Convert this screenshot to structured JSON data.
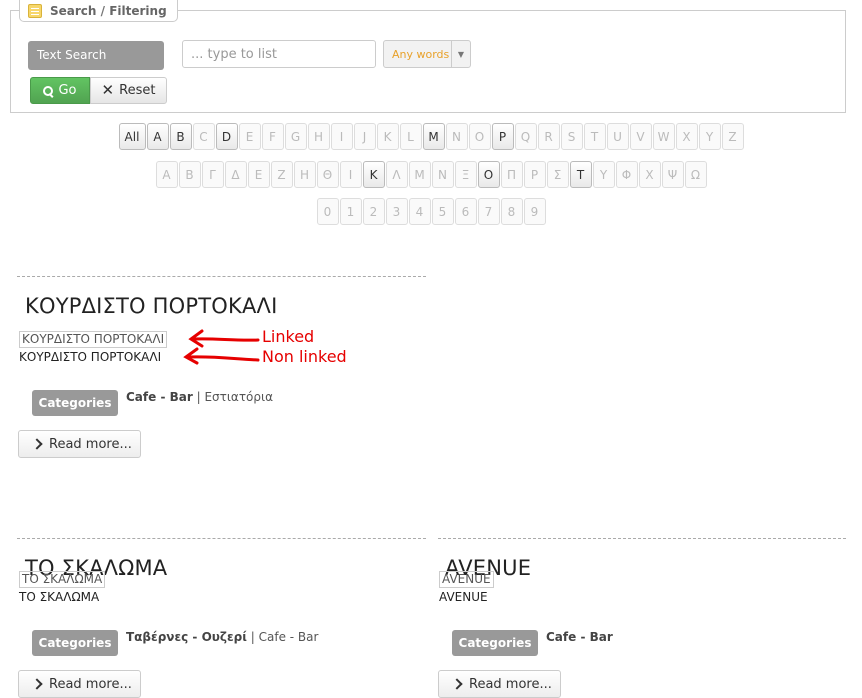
{
  "search": {
    "legend_part1": "Search",
    "legend_sep": " / ",
    "legend_part2": "Filtering",
    "label": "Text Search",
    "placeholder": "... type to list",
    "mode": "Any words",
    "go": "Go",
    "reset": "Reset"
  },
  "alphabet": {
    "latin": [
      {
        "t": "All",
        "a": true
      },
      {
        "t": "A",
        "a": true
      },
      {
        "t": "B",
        "a": true
      },
      {
        "t": "C",
        "a": false
      },
      {
        "t": "D",
        "a": true
      },
      {
        "t": "E",
        "a": false
      },
      {
        "t": "F",
        "a": false
      },
      {
        "t": "G",
        "a": false
      },
      {
        "t": "H",
        "a": false
      },
      {
        "t": "I",
        "a": false
      },
      {
        "t": "J",
        "a": false
      },
      {
        "t": "K",
        "a": false
      },
      {
        "t": "L",
        "a": false
      },
      {
        "t": "M",
        "a": true
      },
      {
        "t": "N",
        "a": false
      },
      {
        "t": "O",
        "a": false
      },
      {
        "t": "P",
        "a": true
      },
      {
        "t": "Q",
        "a": false
      },
      {
        "t": "R",
        "a": false
      },
      {
        "t": "S",
        "a": false
      },
      {
        "t": "T",
        "a": false
      },
      {
        "t": "U",
        "a": false
      },
      {
        "t": "V",
        "a": false
      },
      {
        "t": "W",
        "a": false
      },
      {
        "t": "X",
        "a": false
      },
      {
        "t": "Y",
        "a": false
      },
      {
        "t": "Z",
        "a": false
      }
    ],
    "greek": [
      {
        "t": "Α",
        "a": false
      },
      {
        "t": "Β",
        "a": false
      },
      {
        "t": "Γ",
        "a": false
      },
      {
        "t": "Δ",
        "a": false
      },
      {
        "t": "Ε",
        "a": false
      },
      {
        "t": "Ζ",
        "a": false
      },
      {
        "t": "Η",
        "a": false
      },
      {
        "t": "Θ",
        "a": false
      },
      {
        "t": "Ι",
        "a": false
      },
      {
        "t": "Κ",
        "a": true
      },
      {
        "t": "Λ",
        "a": false
      },
      {
        "t": "Μ",
        "a": false
      },
      {
        "t": "Ν",
        "a": false
      },
      {
        "t": "Ξ",
        "a": false
      },
      {
        "t": "Ο",
        "a": true
      },
      {
        "t": "Π",
        "a": false
      },
      {
        "t": "Ρ",
        "a": false
      },
      {
        "t": "Σ",
        "a": false
      },
      {
        "t": "Τ",
        "a": true
      },
      {
        "t": "Υ",
        "a": false
      },
      {
        "t": "Φ",
        "a": false
      },
      {
        "t": "Χ",
        "a": false
      },
      {
        "t": "Ψ",
        "a": false
      },
      {
        "t": "Ω",
        "a": false
      }
    ],
    "digits": [
      {
        "t": "0",
        "a": false
      },
      {
        "t": "1",
        "a": false
      },
      {
        "t": "2",
        "a": false
      },
      {
        "t": "3",
        "a": false
      },
      {
        "t": "4",
        "a": false
      },
      {
        "t": "5",
        "a": false
      },
      {
        "t": "6",
        "a": false
      },
      {
        "t": "7",
        "a": false
      },
      {
        "t": "8",
        "a": false
      },
      {
        "t": "9",
        "a": false
      }
    ]
  },
  "items": [
    {
      "title": "ΚΟΥΡΔΙΣΤΟ ΠΟΡΤΟΚΑΛΙ",
      "linked": "ΚΟΥΡΔΙΣΤΟ ΠΟΡΤΟΚΑΛΙ",
      "nonlinked": "ΚΟΥΡΔΙΣΤΟ ΠΟΡΤΟΚΑΛΙ",
      "categories_label": "Categories",
      "cat_bold": "Cafe - Bar",
      "cat_sep": " | ",
      "cat_rest": "Εστιατόρια",
      "readmore": "Read more..."
    },
    {
      "title": "ΤΟ ΣΚΑΛΩΜΑ",
      "linked": "ΤΟ ΣΚΑΛΩΜΑ",
      "nonlinked": "ΤΟ ΣΚΑΛΩΜΑ",
      "categories_label": "Categories",
      "cat_bold": "Ταβέρνες - Ουζερί",
      "cat_sep": " | ",
      "cat_rest": "Cafe - Bar",
      "readmore": "Read more..."
    },
    {
      "title": "AVENUE",
      "linked": "AVENUE",
      "nonlinked": "AVENUE",
      "categories_label": "Categories",
      "cat_bold": "Cafe - Bar",
      "cat_sep": "",
      "cat_rest": "",
      "readmore": "Read more..."
    }
  ],
  "annotations": {
    "linked": "Linked",
    "nonlinked": "Non linked",
    "color": "#e60000"
  }
}
